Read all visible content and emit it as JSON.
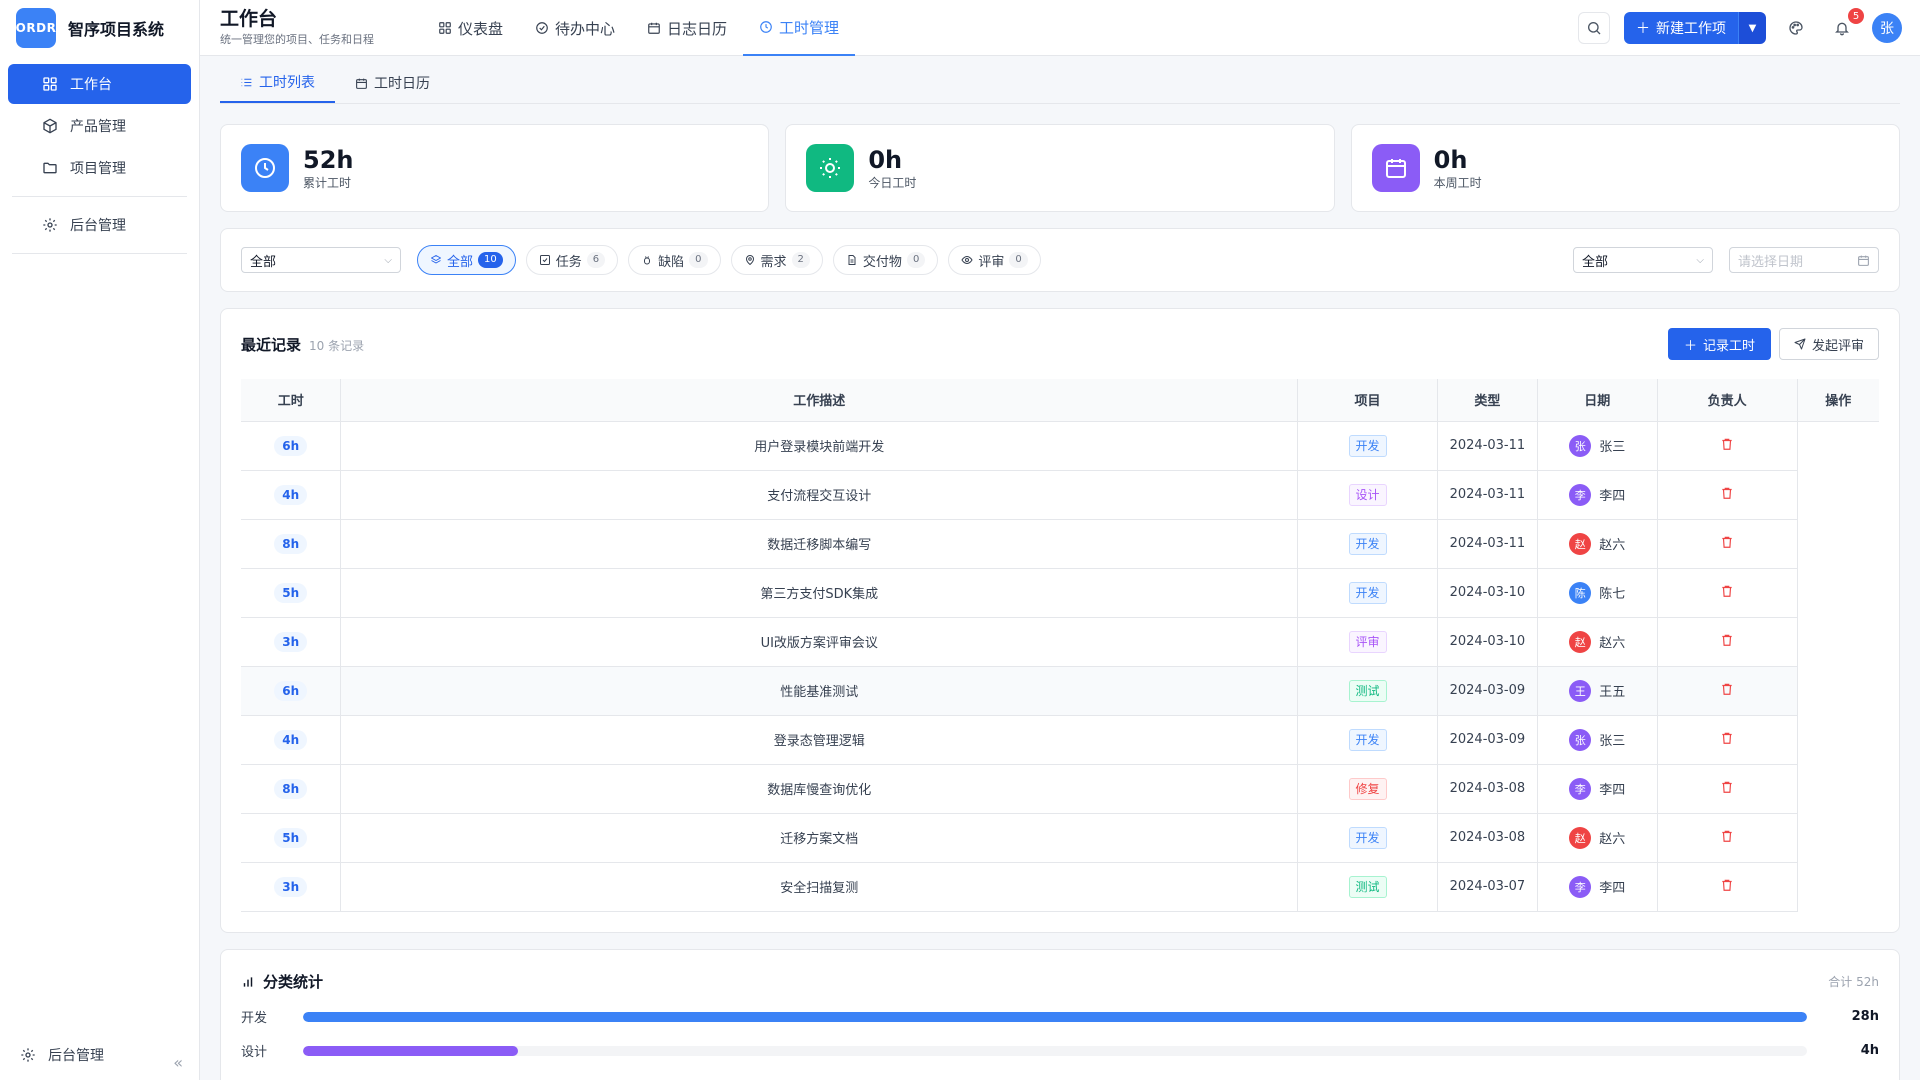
{
  "app": {
    "logo_text": "ORDR",
    "name": "智序项目系统"
  },
  "sidebar": {
    "items": [
      {
        "label": "工作台",
        "icon": "grid-icon",
        "active": true
      },
      {
        "label": "产品管理",
        "icon": "cube-icon"
      },
      {
        "label": "项目管理",
        "icon": "folder-icon"
      },
      {
        "label": "后台管理",
        "icon": "gear-icon"
      }
    ],
    "bottom_label": "后台管理",
    "collapse_glyph": "«"
  },
  "header": {
    "title": "工作台",
    "subtitle": "统一管理您的项目、任务和日程",
    "tabs": [
      {
        "label": "仪表盘",
        "icon": "grid-icon"
      },
      {
        "label": "待办中心",
        "icon": "check-circle-icon"
      },
      {
        "label": "日志日历",
        "icon": "calendar-icon"
      },
      {
        "label": "工时管理",
        "icon": "clock-icon",
        "active": true
      }
    ],
    "new_button": "新建工作项",
    "notification_count": "5",
    "user_avatar": "张"
  },
  "subtabs": [
    {
      "label": "工时列表",
      "icon": "list-icon",
      "active": true
    },
    {
      "label": "工时日历",
      "icon": "calendar-icon"
    }
  ],
  "stats": [
    {
      "value": "52h",
      "label": "累计工时",
      "color": "#3b82f6",
      "icon": "clock-icon"
    },
    {
      "value": "0h",
      "label": "今日工时",
      "color": "#10b981",
      "icon": "sun-icon"
    },
    {
      "value": "0h",
      "label": "本周工时",
      "color": "#8b5cf6",
      "icon": "calendar-icon"
    }
  ],
  "filters": {
    "project_select": "全部",
    "chips": [
      {
        "label": "全部",
        "count": "10",
        "icon": "layers-icon",
        "active": true
      },
      {
        "label": "任务",
        "count": "6",
        "icon": "check-square-icon"
      },
      {
        "label": "缺陷",
        "count": "0",
        "icon": "bug-icon"
      },
      {
        "label": "需求",
        "count": "2",
        "icon": "pin-icon"
      },
      {
        "label": "交付物",
        "count": "0",
        "icon": "file-icon"
      },
      {
        "label": "评审",
        "count": "0",
        "icon": "eye-icon"
      }
    ],
    "member_select": "全部",
    "date_placeholder": "请选择日期"
  },
  "records": {
    "title": "最近记录",
    "count_text": "10 条记录",
    "log_button": "记录工时",
    "review_button": "发起评审",
    "columns": [
      "工时",
      "工作描述",
      "项目",
      "类型",
      "日期",
      "负责人",
      "操作"
    ],
    "rows": [
      {
        "hours": "6h",
        "desc": "用户登录模块前端开发",
        "tag": "开发",
        "date": "2024-03-11",
        "owner": "张三",
        "initial": "张",
        "avatar_color": "#8b5cf6"
      },
      {
        "hours": "4h",
        "desc": "支付流程交互设计",
        "tag": "设计",
        "date": "2024-03-11",
        "owner": "李四",
        "initial": "李",
        "avatar_color": "#8b5cf6"
      },
      {
        "hours": "8h",
        "desc": "数据迁移脚本编写",
        "tag": "开发",
        "date": "2024-03-11",
        "owner": "赵六",
        "initial": "赵",
        "avatar_color": "#ef4444"
      },
      {
        "hours": "5h",
        "desc": "第三方支付SDK集成",
        "tag": "开发",
        "date": "2024-03-10",
        "owner": "陈七",
        "initial": "陈",
        "avatar_color": "#3b82f6"
      },
      {
        "hours": "3h",
        "desc": "UI改版方案评审会议",
        "tag": "评审",
        "date": "2024-03-10",
        "owner": "赵六",
        "initial": "赵",
        "avatar_color": "#ef4444"
      },
      {
        "hours": "6h",
        "desc": "性能基准测试",
        "tag": "测试",
        "date": "2024-03-09",
        "owner": "王五",
        "initial": "王",
        "avatar_color": "#8b5cf6"
      },
      {
        "hours": "4h",
        "desc": "登录态管理逻辑",
        "tag": "开发",
        "date": "2024-03-09",
        "owner": "张三",
        "initial": "张",
        "avatar_color": "#8b5cf6"
      },
      {
        "hours": "8h",
        "desc": "数据库慢查询优化",
        "tag": "修复",
        "date": "2024-03-08",
        "owner": "李四",
        "initial": "李",
        "avatar_color": "#8b5cf6"
      },
      {
        "hours": "5h",
        "desc": "迁移方案文档",
        "tag": "开发",
        "date": "2024-03-08",
        "owner": "赵六",
        "initial": "赵",
        "avatar_color": "#ef4444"
      },
      {
        "hours": "3h",
        "desc": "安全扫描复测",
        "tag": "测试",
        "date": "2024-03-07",
        "owner": "李四",
        "initial": "李",
        "avatar_color": "#8b5cf6"
      }
    ]
  },
  "tag_colors": {
    "开发": {
      "fg": "#3b82f6",
      "bg": "#eff6ff",
      "border": "#bfdbfe"
    },
    "设计": {
      "fg": "#a855f7",
      "bg": "#faf5ff",
      "border": "#e9d5ff"
    },
    "评审": {
      "fg": "#a855f7",
      "bg": "#faf5ff",
      "border": "#e9d5ff"
    },
    "测试": {
      "fg": "#10b981",
      "bg": "#ecfdf5",
      "border": "#a7f3d0"
    },
    "修复": {
      "fg": "#ef4444",
      "bg": "#fef2f2",
      "border": "#fecaca"
    }
  },
  "category_stats": {
    "title": "分类统计",
    "total_text": "合计 52h",
    "items": [
      {
        "name": "开发",
        "value": "28h",
        "fraction": 1.0,
        "color": "#3b82f6"
      },
      {
        "name": "设计",
        "value": "4h",
        "fraction": 0.143,
        "color": "#8b5cf6"
      }
    ]
  }
}
